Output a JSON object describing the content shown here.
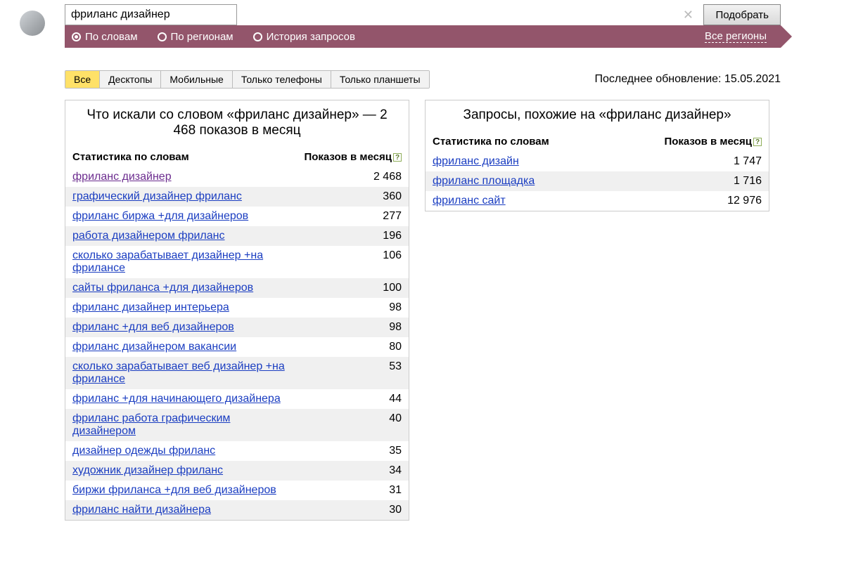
{
  "search": {
    "value": "фриланс дизайнер",
    "submit_label": "Подобрать"
  },
  "radios": {
    "by_words": "По словам",
    "by_regions": "По регионам",
    "history": "История запросов"
  },
  "region_selector": "Все регионы",
  "device_tabs": [
    "Все",
    "Десктопы",
    "Мобильные",
    "Только телефоны",
    "Только планшеты"
  ],
  "last_update": "Последнее обновление: 15.05.2021",
  "left_panel": {
    "title": "Что искали со словом «фриланс дизайнер» — 2 468 показов в месяц",
    "col_stat": "Статистика по словам",
    "col_count": "Показов в месяц",
    "rows": [
      {
        "kw": "фриланс дизайнер",
        "count": "2 468",
        "visited": true
      },
      {
        "kw": "графический дизайнер фриланс",
        "count": "360"
      },
      {
        "kw": "фриланс биржа +для дизайнеров",
        "count": "277"
      },
      {
        "kw": "работа дизайнером фриланс",
        "count": "196"
      },
      {
        "kw": "сколько зарабатывает дизайнер +на фрилансе",
        "count": "106"
      },
      {
        "kw": "сайты фриланса +для дизайнеров",
        "count": "100"
      },
      {
        "kw": "фриланс дизайнер интерьера",
        "count": "98"
      },
      {
        "kw": "фриланс +для веб дизайнеров",
        "count": "98"
      },
      {
        "kw": "фриланс дизайнером вакансии",
        "count": "80"
      },
      {
        "kw": "сколько зарабатывает веб дизайнер +на фрилансе",
        "count": "53"
      },
      {
        "kw": "фриланс +для начинающего дизайнера",
        "count": "44"
      },
      {
        "kw": "фриланс работа графическим дизайнером",
        "count": "40"
      },
      {
        "kw": "дизайнер одежды фриланс",
        "count": "35"
      },
      {
        "kw": "художник дизайнер фриланс",
        "count": "34"
      },
      {
        "kw": "биржи фриланса +для веб дизайнеров",
        "count": "31"
      },
      {
        "kw": "фриланс найти дизайнера",
        "count": "30"
      }
    ]
  },
  "right_panel": {
    "title": "Запросы, похожие на «фриланс дизайнер»",
    "col_stat": "Статистика по словам",
    "col_count": "Показов в месяц",
    "rows": [
      {
        "kw": "фриланс дизайн",
        "count": "1 747"
      },
      {
        "kw": "фриланс площадка",
        "count": "1 716"
      },
      {
        "kw": "фриланс сайт",
        "count": "12 976"
      }
    ]
  }
}
